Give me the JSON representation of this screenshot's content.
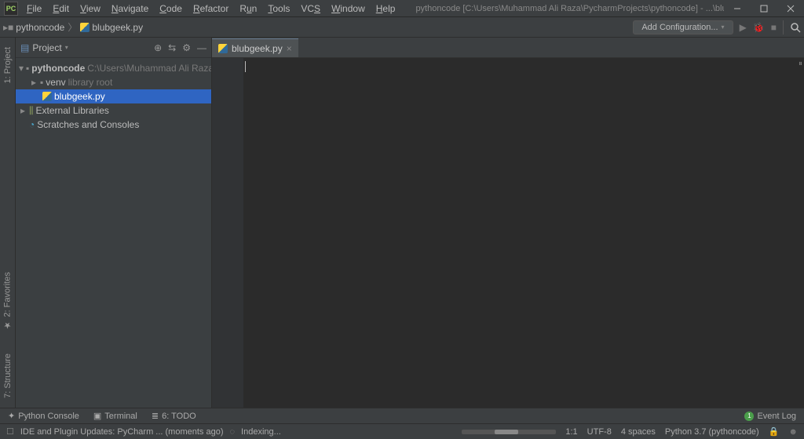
{
  "title_bar": {
    "app_icon_label": "PC",
    "title": "pythoncode [C:\\Users\\Muhammad Ali Raza\\PycharmProjects\\pythoncode] - ...\\blubgeek.py"
  },
  "menu": {
    "file": "File",
    "edit": "Edit",
    "view": "View",
    "navigate": "Navigate",
    "code": "Code",
    "refactor": "Refactor",
    "run": "Run",
    "tools": "Tools",
    "vcs": "VCS",
    "window": "Window",
    "help": "Help"
  },
  "breadcrumb": {
    "project": "pythoncode",
    "file": "blubgeek.py"
  },
  "toolbar": {
    "add_config": "Add Configuration..."
  },
  "gutter": {
    "project": "1: Project",
    "favorites": "2: Favorites",
    "structure": "7: Structure"
  },
  "panel": {
    "title": "Project"
  },
  "tree": {
    "root_name": "pythoncode",
    "root_path": "C:\\Users\\Muhammad Ali Raza\\PycharmProjects\\pythoncode",
    "venv": "venv",
    "venv_hint": "library root",
    "file": "blubgeek.py",
    "ext_libs": "External Libraries",
    "scratches": "Scratches and Consoles"
  },
  "editor": {
    "tab_label": "blubgeek.py"
  },
  "bottom_tabs": {
    "python_console": "Python Console",
    "terminal": "Terminal",
    "todo": "6: TODO",
    "event_log": "Event Log"
  },
  "status": {
    "message": "IDE and Plugin Updates: PyCharm ... (moments ago)",
    "indexing": "Indexing...",
    "position": "1:1",
    "encoding": "UTF-8",
    "indent": "4 spaces",
    "interpreter": "Python 3.7 (pythoncode)"
  }
}
